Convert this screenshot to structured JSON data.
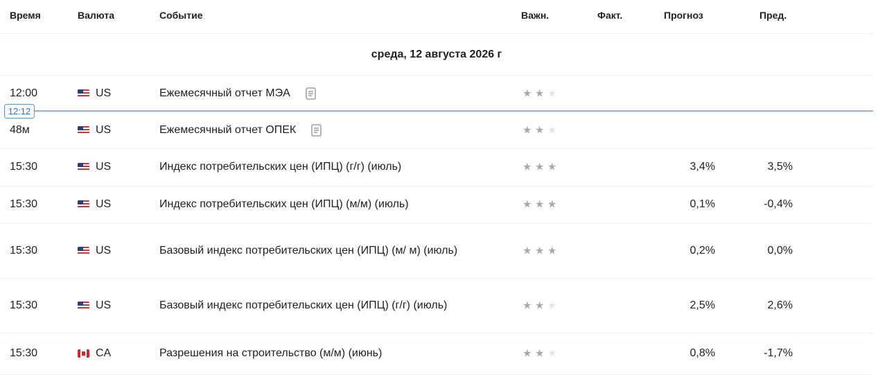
{
  "columns": {
    "time": "Время",
    "currency": "Валюта",
    "event": "Событие",
    "importance": "Важн.",
    "actual": "Факт.",
    "forecast": "Прогноз",
    "previous": "Пред."
  },
  "day_header": "среда, 12 августа 2026 г",
  "current_time_badge": "12:12",
  "rows": [
    {
      "time": "12:00",
      "flag": "us-flag-icon",
      "currency": "US",
      "event": "Ежемесячный отчет МЭА",
      "has_doc": true,
      "importance": 2,
      "actual": "",
      "forecast": "",
      "previous": ""
    },
    {
      "time": "48м",
      "flag": "us-flag-icon",
      "currency": "US",
      "event": "Ежемесячный отчет ОПЕК",
      "has_doc": true,
      "importance": 2,
      "actual": "",
      "forecast": "",
      "previous": ""
    },
    {
      "time": "15:30",
      "flag": "us-flag-icon",
      "currency": "US",
      "event": "Индекс потребительских цен (ИПЦ) (г/г) (июль)",
      "has_doc": false,
      "importance": 3,
      "actual": "",
      "forecast": "3,4%",
      "previous": "3,5%"
    },
    {
      "time": "15:30",
      "flag": "us-flag-icon",
      "currency": "US",
      "event": "Индекс потребительских цен (ИПЦ) (м/м) (июль)",
      "has_doc": false,
      "importance": 3,
      "actual": "",
      "forecast": "0,1%",
      "previous": "-0,4%"
    },
    {
      "time": "15:30",
      "flag": "us-flag-icon",
      "currency": "US",
      "event": "Базовый индекс потребительских цен (ИПЦ) (м/ м) (июль)",
      "has_doc": false,
      "importance": 3,
      "actual": "",
      "forecast": "0,2%",
      "previous": "0,0%"
    },
    {
      "time": "15:30",
      "flag": "us-flag-icon",
      "currency": "US",
      "event": "Базовый индекс потребительских цен (ИПЦ) (г/г) (июль)",
      "has_doc": false,
      "importance": 2,
      "actual": "",
      "forecast": "2,5%",
      "previous": "2,6%"
    },
    {
      "time": "15:30",
      "flag": "ca-flag-icon",
      "currency": "CA",
      "event": "Разрешения на строительство (м/м) (июнь)",
      "has_doc": false,
      "importance": 2,
      "actual": "",
      "forecast": "0,8%",
      "previous": "-1,7%"
    }
  ],
  "colors": {
    "star_active": "#a7a9ad",
    "star_inactive": "#e5e6e8",
    "now_line": "#8fb5f0",
    "now_badge_text": "#2d6fe0"
  }
}
